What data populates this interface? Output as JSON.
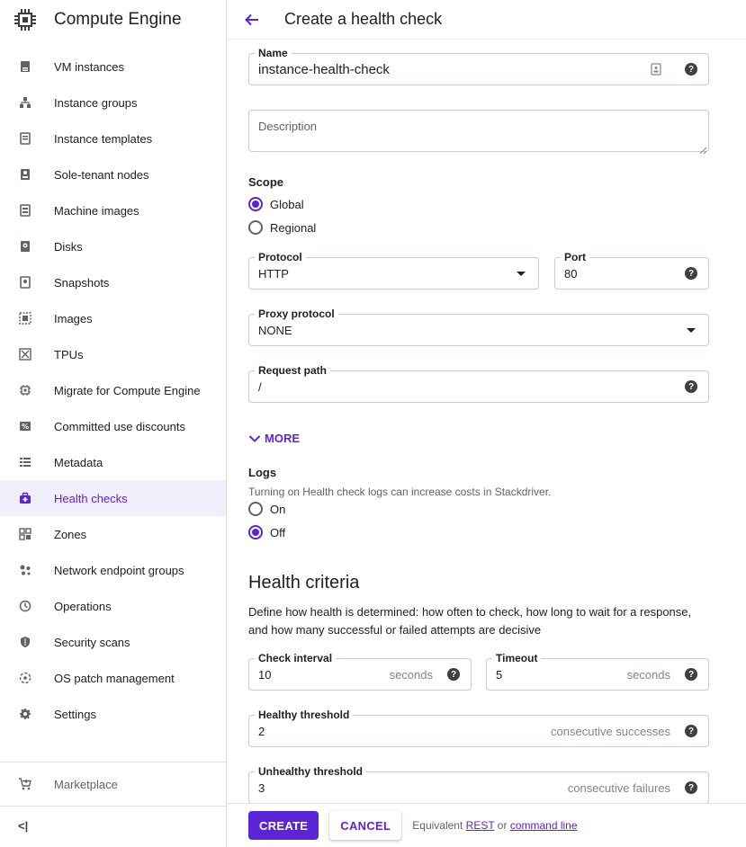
{
  "app": {
    "product_name": "Compute Engine"
  },
  "sidebar": {
    "items": [
      {
        "label": "VM instances",
        "icon": "vm-icon"
      },
      {
        "label": "Instance groups",
        "icon": "groups-icon"
      },
      {
        "label": "Instance templates",
        "icon": "template-icon"
      },
      {
        "label": "Sole-tenant nodes",
        "icon": "node-icon"
      },
      {
        "label": "Machine images",
        "icon": "machine-image-icon"
      },
      {
        "label": "Disks",
        "icon": "disk-icon"
      },
      {
        "label": "Snapshots",
        "icon": "snapshot-icon"
      },
      {
        "label": "Images",
        "icon": "images-icon"
      },
      {
        "label": "TPUs",
        "icon": "tpu-icon"
      },
      {
        "label": "Migrate for Compute Engine",
        "icon": "migrate-icon"
      },
      {
        "label": "Committed use discounts",
        "icon": "percent-icon"
      },
      {
        "label": "Metadata",
        "icon": "list-icon"
      },
      {
        "label": "Health checks",
        "icon": "medical-bag-icon",
        "active": true
      },
      {
        "label": "Zones",
        "icon": "zones-icon"
      },
      {
        "label": "Network endpoint groups",
        "icon": "dots-icon"
      },
      {
        "label": "Operations",
        "icon": "clock-icon"
      },
      {
        "label": "Security scans",
        "icon": "shield-icon"
      },
      {
        "label": "OS patch management",
        "icon": "patch-icon"
      },
      {
        "label": "Settings",
        "icon": "gear-icon"
      }
    ],
    "marketplace_label": "Marketplace",
    "collapse_label": "<|"
  },
  "header": {
    "title": "Create a health check"
  },
  "form": {
    "name": {
      "label": "Name",
      "value": "instance-health-check"
    },
    "description": {
      "placeholder": "Description"
    },
    "scope": {
      "label": "Scope",
      "options": [
        {
          "label": "Global",
          "selected": true
        },
        {
          "label": "Regional",
          "selected": false
        }
      ]
    },
    "protocol": {
      "label": "Protocol",
      "value": "HTTP"
    },
    "port": {
      "label": "Port",
      "value": "80"
    },
    "proxy_protocol": {
      "label": "Proxy protocol",
      "value": "NONE"
    },
    "request_path": {
      "label": "Request path",
      "value": "/"
    },
    "more_label": "MORE",
    "logs": {
      "label": "Logs",
      "description": "Turning on Health check logs can increase costs in Stackdriver.",
      "options": [
        {
          "label": "On",
          "selected": false
        },
        {
          "label": "Off",
          "selected": true
        }
      ]
    },
    "health_criteria": {
      "title": "Health criteria",
      "description": "Define how health is determined: how often to check, how long to wait for a response, and how many successful or failed attempts are decisive",
      "check_interval": {
        "label": "Check interval",
        "value": "10",
        "unit": "seconds"
      },
      "timeout": {
        "label": "Timeout",
        "value": "5",
        "unit": "seconds"
      },
      "healthy_threshold": {
        "label": "Healthy threshold",
        "value": "2",
        "unit": "consecutive successes"
      },
      "unhealthy_threshold": {
        "label": "Unhealthy threshold",
        "value": "3",
        "unit": "consecutive failures"
      }
    }
  },
  "footer": {
    "create_label": "CREATE",
    "cancel_label": "CANCEL",
    "equivalent_prefix": "Equivalent",
    "rest_label": "REST",
    "or_label": "or",
    "command_line_label": "command line"
  },
  "colors": {
    "accent": "#5b24d6",
    "active_bg": "#f1effc"
  }
}
